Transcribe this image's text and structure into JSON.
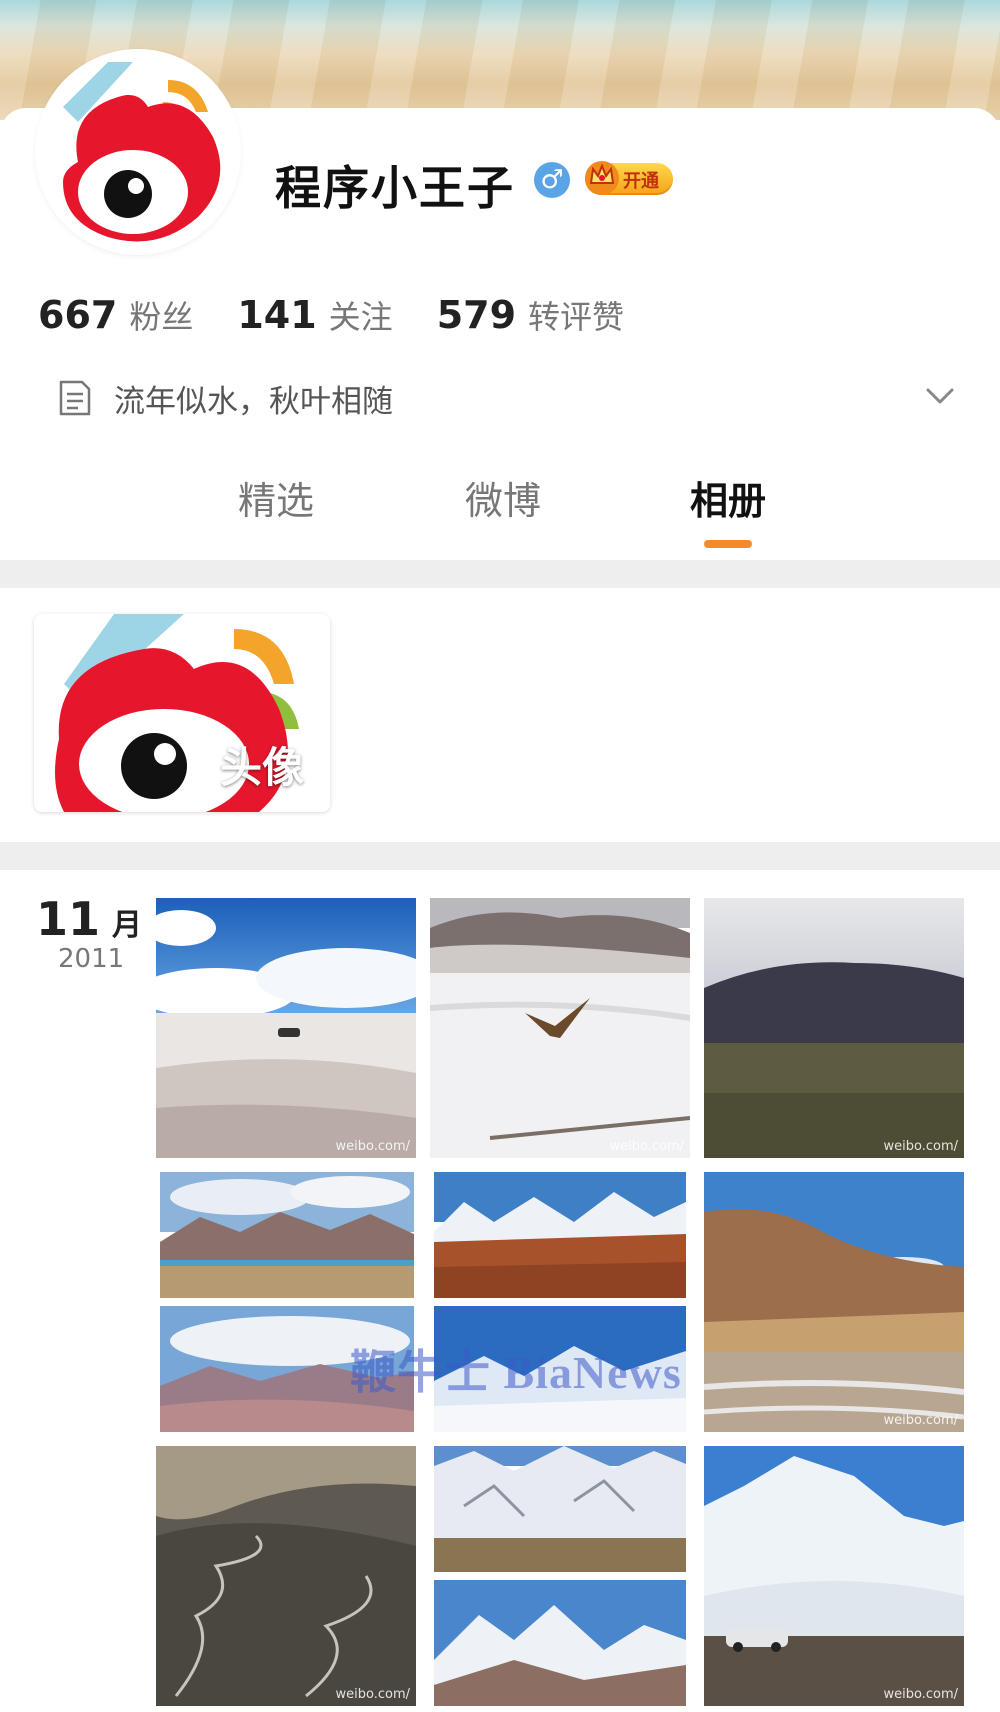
{
  "profile": {
    "name": "程序小王子",
    "gender_symbol": "♂",
    "vip_label": "开通",
    "stats": [
      {
        "value": "667",
        "label": "粉丝"
      },
      {
        "value": "141",
        "label": "关注"
      },
      {
        "value": "579",
        "label": "转评赞"
      }
    ],
    "bio": "流年似水，秋叶相随"
  },
  "tabs": [
    {
      "label": "精选",
      "active": false
    },
    {
      "label": "微博",
      "active": false
    },
    {
      "label": "相册",
      "active": true
    }
  ],
  "album": {
    "avatar_album_label": "头像",
    "month": "11",
    "month_unit": "月",
    "year": "2011",
    "photo_watermark": "weibo.com/"
  },
  "overlay_watermark": "鞭牛士 BiaNews",
  "colors": {
    "accent": "#f58a2a",
    "weibo_red": "#e6162d",
    "gender_blue": "#5aa4e6"
  }
}
